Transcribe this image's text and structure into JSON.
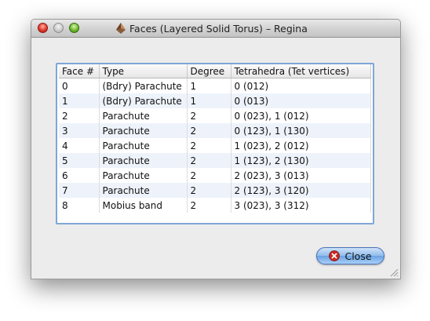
{
  "window": {
    "title": "Faces (Layered Solid Torus) – Regina"
  },
  "table": {
    "headers": [
      "Face #",
      "Type",
      "Degree",
      "Tetrahedra (Tet vertices)"
    ],
    "rows": [
      [
        "0",
        "(Bdry) Parachute",
        "1",
        "0 (012)"
      ],
      [
        "1",
        "(Bdry) Parachute",
        "1",
        "0 (013)"
      ],
      [
        "2",
        "Parachute",
        "2",
        "0 (023), 1 (012)"
      ],
      [
        "3",
        "Parachute",
        "2",
        "0 (123), 1 (130)"
      ],
      [
        "4",
        "Parachute",
        "2",
        "1 (023), 2 (012)"
      ],
      [
        "5",
        "Parachute",
        "2",
        "1 (123), 2 (130)"
      ],
      [
        "6",
        "Parachute",
        "2",
        "2 (023), 3 (013)"
      ],
      [
        "7",
        "Parachute",
        "2",
        "2 (123), 3 (120)"
      ],
      [
        "8",
        "Mobius band",
        "2",
        "3 (023), 3 (312)"
      ]
    ]
  },
  "buttons": {
    "close_label": "Close"
  },
  "icons": {
    "app": "regina-app-icon",
    "close": "close-icon"
  },
  "colors": {
    "selection_border": "#7fa6d9",
    "alt_row": "#eef3fb",
    "close_icon": "#c8281f"
  }
}
